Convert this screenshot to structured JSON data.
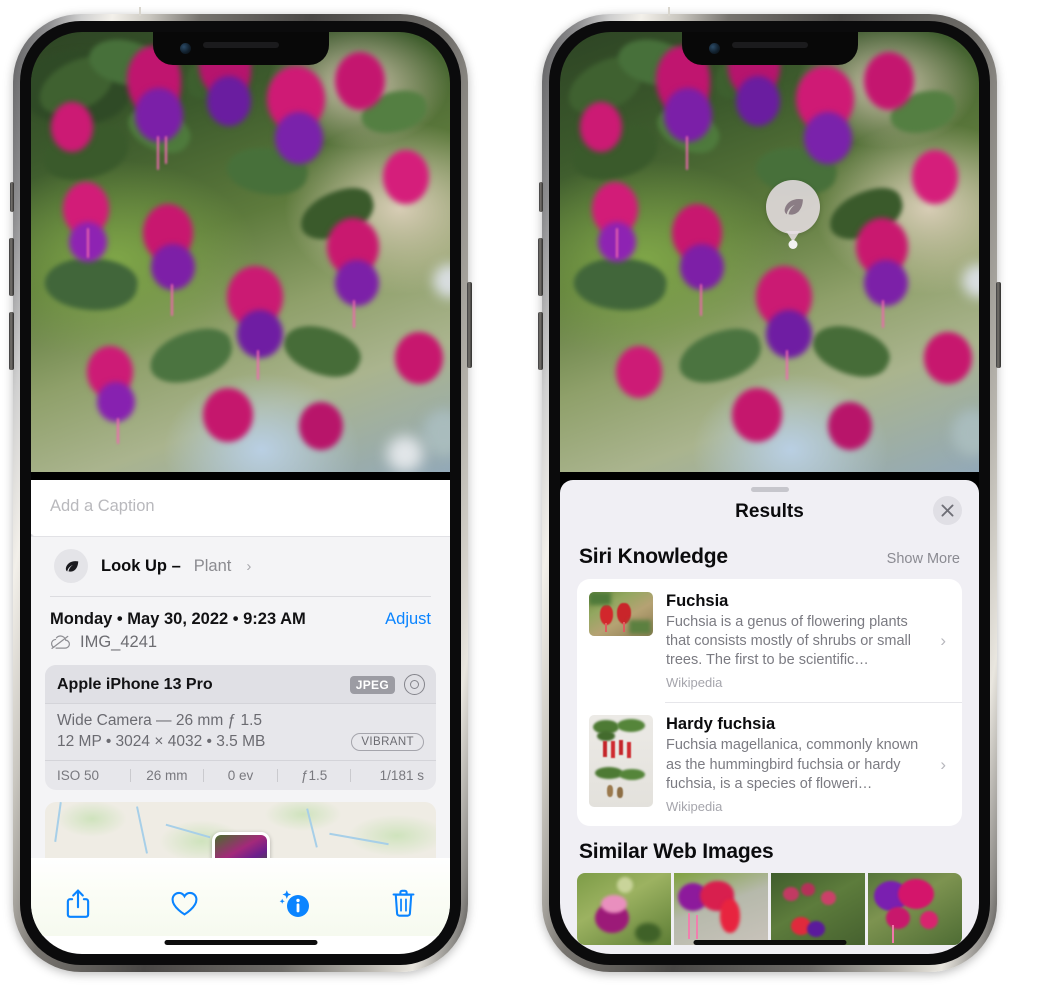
{
  "left_phone": {
    "caption": {
      "placeholder": "Add a Caption",
      "value": ""
    },
    "lookup": {
      "label": "Look Up –",
      "value": "Plant",
      "chevron": "›",
      "icon": "leaf-icon"
    },
    "meta": {
      "date": "Monday • May 30, 2022 • 9:23 AM",
      "adjust": "Adjust",
      "filename": "IMG_4241",
      "cloud_icon": "cloud-slash-icon"
    },
    "camera_card": {
      "model": "Apple iPhone 13 Pro",
      "format_chip": "JPEG",
      "raw_icon": "raw-circle-icon",
      "lens_line": "Wide Camera — 26 mm ƒ 1.5",
      "specs_line": "12 MP • 3024 × 4032 • 3.5 MB",
      "style_chip": "VIBRANT",
      "exif": [
        "ISO 50",
        "26 mm",
        "0 ev",
        "ƒ1.5",
        "1/181 s"
      ]
    },
    "toolbar": [
      {
        "name": "share-icon",
        "label": "Share"
      },
      {
        "name": "heart-icon",
        "label": "Favorite"
      },
      {
        "name": "info-sparkle-icon",
        "label": "Info"
      },
      {
        "name": "trash-icon",
        "label": "Delete"
      }
    ]
  },
  "right_phone": {
    "vlu_pin": {
      "icon": "leaf-icon"
    },
    "sheet": {
      "title": "Results",
      "close_icon": "close-icon"
    },
    "siri_knowledge": {
      "title": "Siri Knowledge",
      "show_more": "Show More",
      "items": [
        {
          "title": "Fuchsia",
          "description": "Fuchsia is a genus of flowering plants that consists mostly of shrubs or small trees. The first to be scientific…",
          "source": "Wikipedia",
          "thumb": "fuchsia-thumb",
          "chevron": "›"
        },
        {
          "title": "Hardy fuchsia",
          "description": "Fuchsia magellanica, commonly known as the hummingbird fuchsia or hardy fuchsia, is a species of floweri…",
          "source": "Wikipedia",
          "thumb": "hardy-fuchsia-thumb",
          "chevron": "›"
        }
      ]
    },
    "similar_web_images": {
      "title": "Similar Web Images",
      "tiles": [
        "web-image-1",
        "web-image-2",
        "web-image-3",
        "web-image-4"
      ]
    }
  },
  "colors": {
    "accent_blue": "#0a84ff",
    "sheet_bg": "#f0eff4",
    "card_bg": "#ffffff",
    "info_bg": "#f4f4f6",
    "cam_card_bg": "#e7e7eb",
    "secondary_text": "#7b7b82"
  }
}
